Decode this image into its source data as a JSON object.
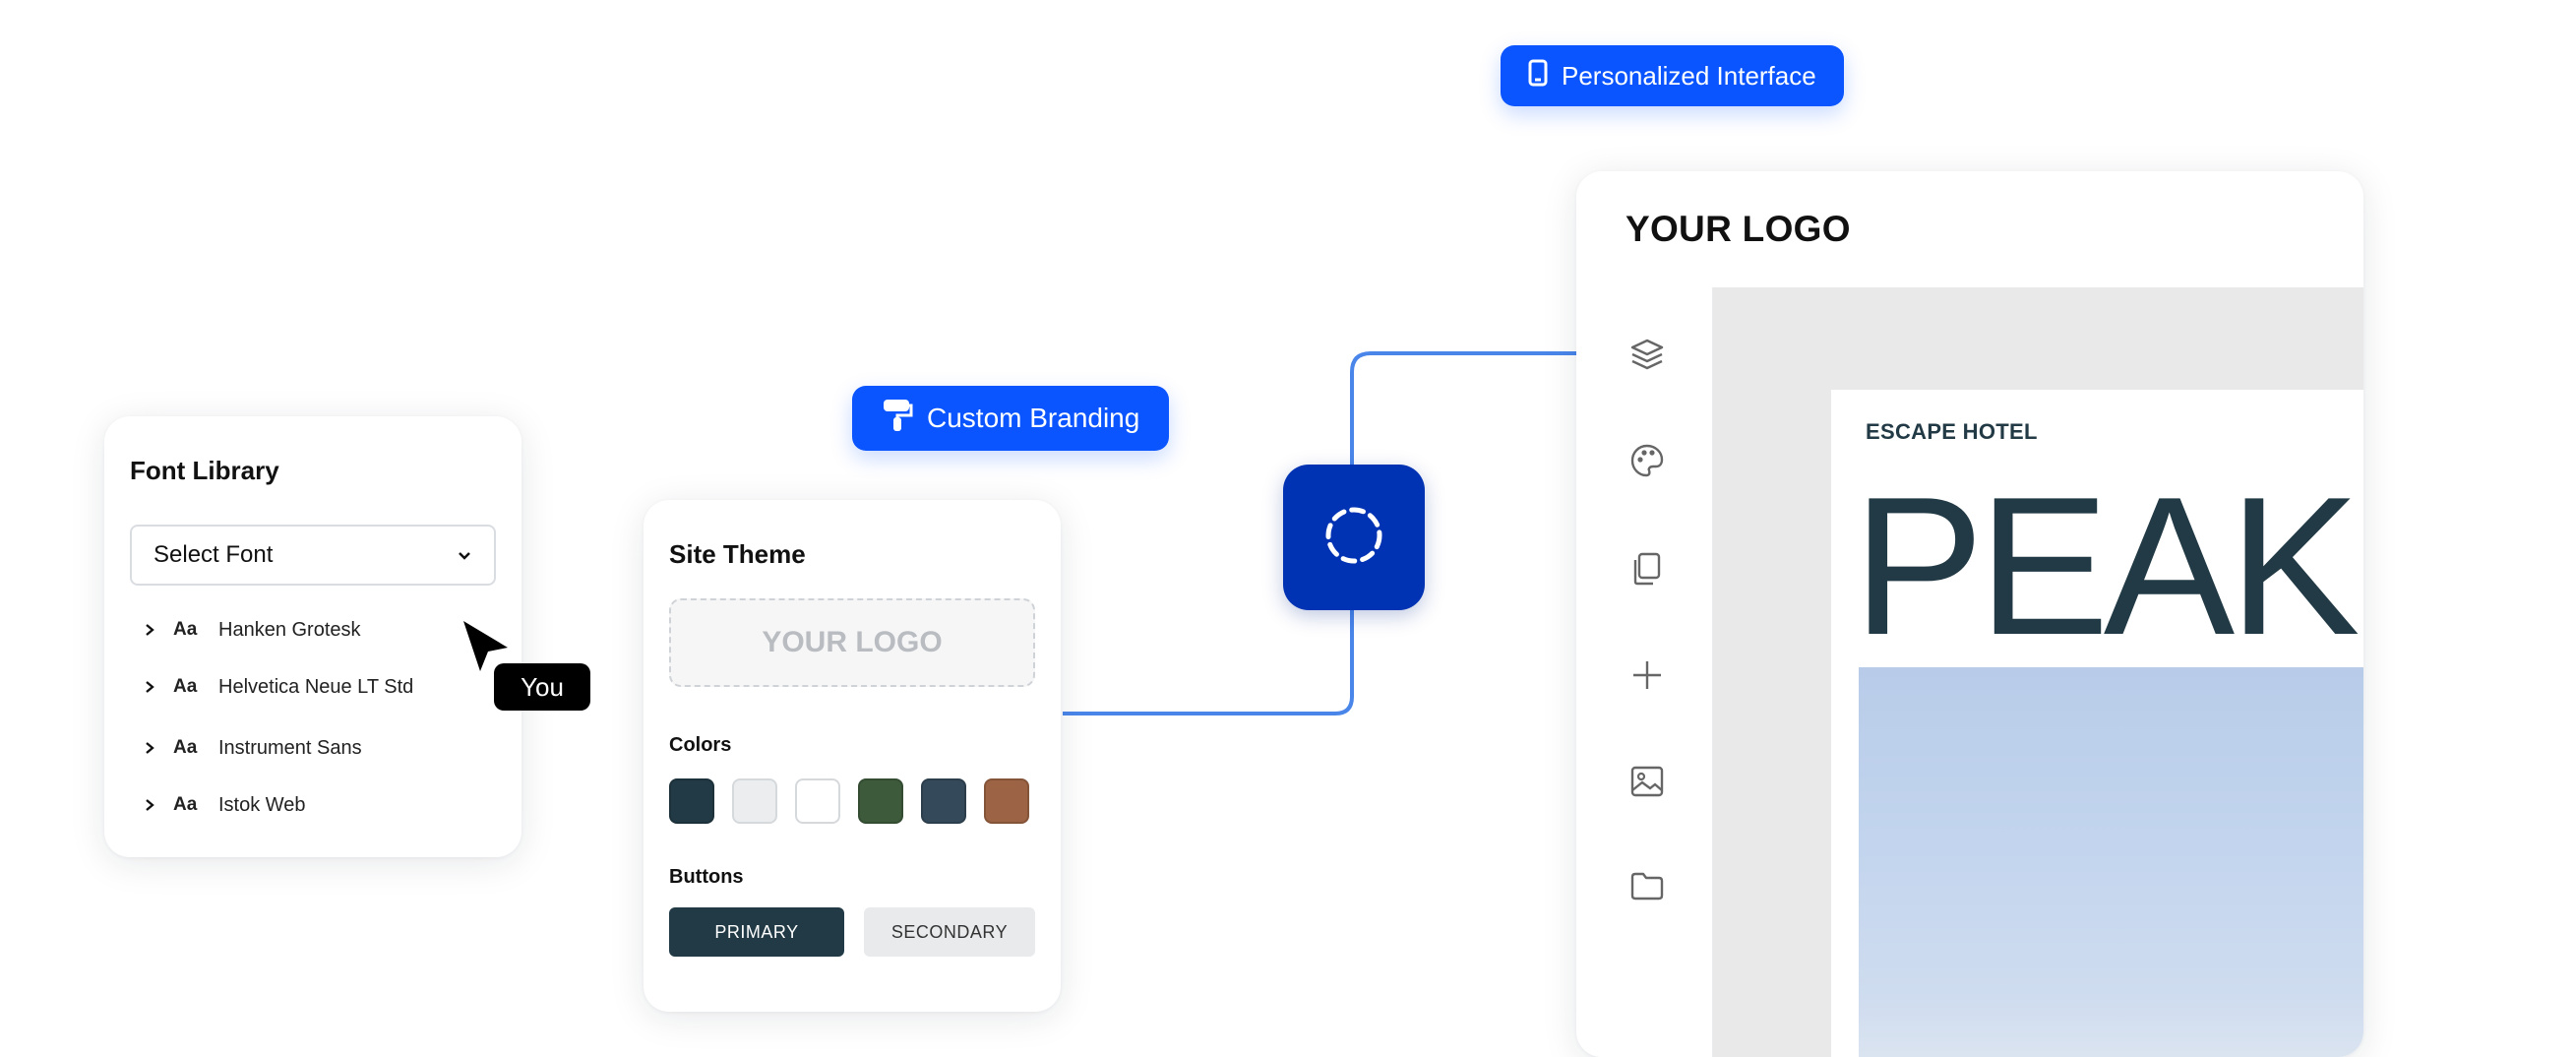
{
  "badges": {
    "personalized": "Personalized Interface",
    "branding": "Custom Branding"
  },
  "font_library": {
    "title": "Font Library",
    "select_placeholder": "Select Font",
    "aa_label": "Aa",
    "fonts": [
      "Hanken Grotesk",
      "Helvetica Neue LT Std",
      "Instrument Sans",
      "Istok Web"
    ]
  },
  "cursor": {
    "label": "You"
  },
  "site_theme": {
    "title": "Site Theme",
    "logo_placeholder": "YOUR LOGO",
    "colors_label": "Colors",
    "colors": [
      "#213a45",
      "#ecedef",
      "#ffffff",
      "#3d5a3b",
      "#34495a",
      "#9c6344"
    ],
    "buttons_label": "Buttons",
    "primary_label": "PRIMARY",
    "secondary_label": "SECONDARY"
  },
  "app": {
    "logo": "YOUR LOGO",
    "sidebar_icons": [
      "layers-icon",
      "palette-icon",
      "copy-icon",
      "plus-icon",
      "image-icon",
      "folder-icon"
    ],
    "page": {
      "hotel": "ESCAPE HOTEL",
      "headline": "PEAK"
    }
  },
  "colors": {
    "accent_blue": "#0a55ff",
    "node_blue": "#0033b3",
    "connector": "#4a86ea",
    "brand_dark": "#223a45"
  }
}
